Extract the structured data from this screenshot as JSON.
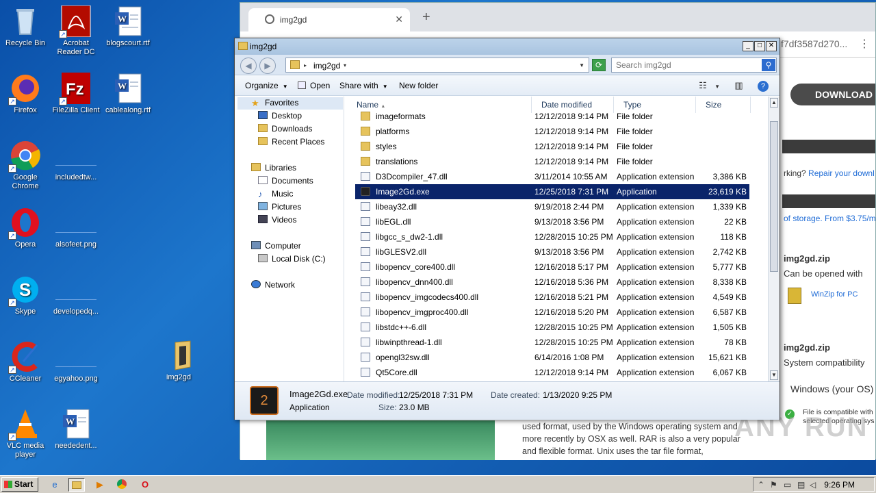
{
  "desktop": {
    "icons": [
      {
        "label": "Recycle Bin"
      },
      {
        "label": "Acrobat Reader DC"
      },
      {
        "label": "blogscourt.rtf"
      },
      {
        "label": "Firefox"
      },
      {
        "label": "FileZilla Client"
      },
      {
        "label": "cablealong.rtf"
      },
      {
        "label": "Google Chrome"
      },
      {
        "label": "includedtw..."
      },
      {
        "label": "Opera"
      },
      {
        "label": "alsofeet.png"
      },
      {
        "label": "Skype"
      },
      {
        "label": "developedq..."
      },
      {
        "label": "CCleaner"
      },
      {
        "label": "egyahoo.png"
      },
      {
        "label": "img2gd"
      },
      {
        "label": "VLC media player"
      },
      {
        "label": "neededent..."
      }
    ]
  },
  "browser": {
    "tab_title": "img2gd",
    "url_fragment": "f7df3587d270...",
    "download_label": "DOWNLOAD",
    "repair_prefix": "rking?",
    "repair_link": "Repair your downl",
    "storage_text": "of storage. From $3.75/m",
    "zip_title_1": "img2gd.zip",
    "opened_with": "Can be opened with",
    "winzip": "WinZip for PC",
    "zip_title_2": "img2gd.zip",
    "system_compat": "System compatibility",
    "os_label": "Windows (your OS)",
    "compat_line_1": "File is compatible with",
    "compat_line_2": "selected operating sys",
    "article_text": "used format, used by the Windows operating system and more recently by OSX as well. RAR is also a very popular and flexible format. Unix uses the tar file format,",
    "watermark": "ANY  RUN"
  },
  "explorer": {
    "title": "img2gd",
    "breadcrumb": "img2gd",
    "search_placeholder": "Search img2gd",
    "toolbar": {
      "organize": "Organize",
      "open": "Open",
      "share_with": "Share with",
      "new_folder": "New folder"
    },
    "nav": {
      "favorites": "Favorites",
      "desktop": "Desktop",
      "downloads": "Downloads",
      "recent": "Recent Places",
      "libraries": "Libraries",
      "documents": "Documents",
      "music": "Music",
      "pictures": "Pictures",
      "videos": "Videos",
      "computer": "Computer",
      "local_disk": "Local Disk (C:)",
      "network": "Network"
    },
    "columns": {
      "name": "Name",
      "date": "Date modified",
      "type": "Type",
      "size": "Size"
    },
    "files": [
      {
        "name": "imageformats",
        "date": "12/12/2018 9:14 PM",
        "type": "File folder",
        "size": "",
        "kind": "folder"
      },
      {
        "name": "platforms",
        "date": "12/12/2018 9:14 PM",
        "type": "File folder",
        "size": "",
        "kind": "folder"
      },
      {
        "name": "styles",
        "date": "12/12/2018 9:14 PM",
        "type": "File folder",
        "size": "",
        "kind": "folder"
      },
      {
        "name": "translations",
        "date": "12/12/2018 9:14 PM",
        "type": "File folder",
        "size": "",
        "kind": "folder"
      },
      {
        "name": "D3Dcompiler_47.dll",
        "date": "3/11/2014 10:55 AM",
        "type": "Application extension",
        "size": "3,386 KB",
        "kind": "dll"
      },
      {
        "name": "Image2Gd.exe",
        "date": "12/25/2018 7:31 PM",
        "type": "Application",
        "size": "23,619 KB",
        "kind": "exe",
        "selected": true
      },
      {
        "name": "libeay32.dll",
        "date": "9/19/2018 2:44 PM",
        "type": "Application extension",
        "size": "1,339 KB",
        "kind": "dll"
      },
      {
        "name": "libEGL.dll",
        "date": "9/13/2018 3:56 PM",
        "type": "Application extension",
        "size": "22 KB",
        "kind": "dll"
      },
      {
        "name": "libgcc_s_dw2-1.dll",
        "date": "12/28/2015 10:25 PM",
        "type": "Application extension",
        "size": "118 KB",
        "kind": "dll"
      },
      {
        "name": "libGLESV2.dll",
        "date": "9/13/2018 3:56 PM",
        "type": "Application extension",
        "size": "2,742 KB",
        "kind": "dll"
      },
      {
        "name": "libopencv_core400.dll",
        "date": "12/16/2018 5:17 PM",
        "type": "Application extension",
        "size": "5,777 KB",
        "kind": "dll"
      },
      {
        "name": "libopencv_dnn400.dll",
        "date": "12/16/2018 5:36 PM",
        "type": "Application extension",
        "size": "8,338 KB",
        "kind": "dll"
      },
      {
        "name": "libopencv_imgcodecs400.dll",
        "date": "12/16/2018 5:21 PM",
        "type": "Application extension",
        "size": "4,549 KB",
        "kind": "dll"
      },
      {
        "name": "libopencv_imgproc400.dll",
        "date": "12/16/2018 5:20 PM",
        "type": "Application extension",
        "size": "6,587 KB",
        "kind": "dll"
      },
      {
        "name": "libstdc++-6.dll",
        "date": "12/28/2015 10:25 PM",
        "type": "Application extension",
        "size": "1,505 KB",
        "kind": "dll"
      },
      {
        "name": "libwinpthread-1.dll",
        "date": "12/28/2015 10:25 PM",
        "type": "Application extension",
        "size": "78 KB",
        "kind": "dll"
      },
      {
        "name": "opengl32sw.dll",
        "date": "6/14/2016 1:08 PM",
        "type": "Application extension",
        "size": "15,621 KB",
        "kind": "dll"
      },
      {
        "name": "Qt5Core.dll",
        "date": "12/12/2018 9:14 PM",
        "type": "Application extension",
        "size": "6,067 KB",
        "kind": "dll"
      }
    ],
    "details": {
      "name": "Image2Gd.exe",
      "kind": "Application",
      "date_modified_label": "Date modified:",
      "date_modified": "12/25/2018 7:31 PM",
      "date_created_label": "Date created:",
      "date_created": "1/13/2020 9:25 PM",
      "size_label": "Size:",
      "size": "23.0 MB"
    }
  },
  "taskbar": {
    "start_label": "Start",
    "clock": "9:26 PM"
  }
}
